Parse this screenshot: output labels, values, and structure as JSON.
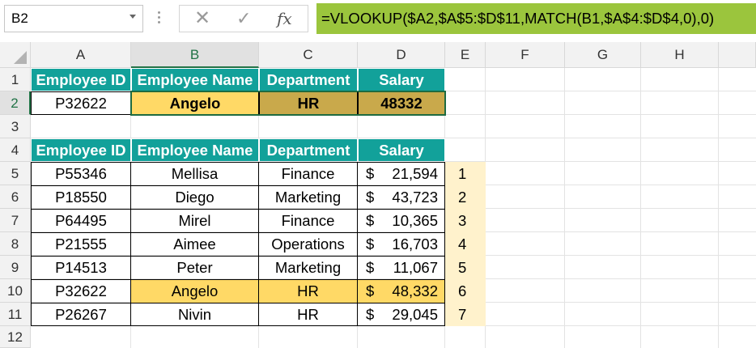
{
  "name_box": "B2",
  "formula": "=VLOOKUP($A2,$A$5:$D$11,MATCH(B1,$A$4:$D$4,0),0)",
  "columns": [
    "A",
    "B",
    "C",
    "D",
    "E",
    "F",
    "G",
    "H"
  ],
  "rows": [
    "1",
    "2",
    "3",
    "4",
    "5",
    "6",
    "7",
    "8",
    "9",
    "10",
    "11",
    "12"
  ],
  "lookup": {
    "headers": [
      "Employee ID",
      "Employee Name",
      "Department",
      "Salary"
    ],
    "id": "P32622",
    "name": "Angelo",
    "dept": "HR",
    "salary": "48332"
  },
  "table": {
    "headers": [
      "Employee ID",
      "Employee Name",
      "Department",
      "Salary"
    ],
    "currency": "$",
    "rows": [
      {
        "id": "P55346",
        "name": "Mellisa",
        "dept": "Finance",
        "salary": "21,594",
        "idx": "1"
      },
      {
        "id": "P18550",
        "name": "Diego",
        "dept": "Marketing",
        "salary": "43,723",
        "idx": "2"
      },
      {
        "id": "P64495",
        "name": "Mirel",
        "dept": "Finance",
        "salary": "10,365",
        "idx": "3"
      },
      {
        "id": "P21555",
        "name": "Aimee",
        "dept": "Operations",
        "salary": "16,703",
        "idx": "4"
      },
      {
        "id": "P14513",
        "name": "Peter",
        "dept": "Marketing",
        "salary": "11,067",
        "idx": "5"
      },
      {
        "id": "P32622",
        "name": "Angelo",
        "dept": "HR",
        "salary": "48,332",
        "idx": "6"
      },
      {
        "id": "P26267",
        "name": "Nivin",
        "dept": "HR",
        "salary": "29,045",
        "idx": "7"
      }
    ]
  },
  "colors": {
    "header_fill": "#12a19a",
    "highlight_yellow": "#ffd966",
    "highlight_gold": "#c9a94b",
    "formula_bar_fill": "#9bc53d",
    "index_fill": "#fff2cc"
  },
  "icons": {
    "cancel": "close-icon",
    "enter": "check-icon",
    "function": "fx-icon"
  }
}
